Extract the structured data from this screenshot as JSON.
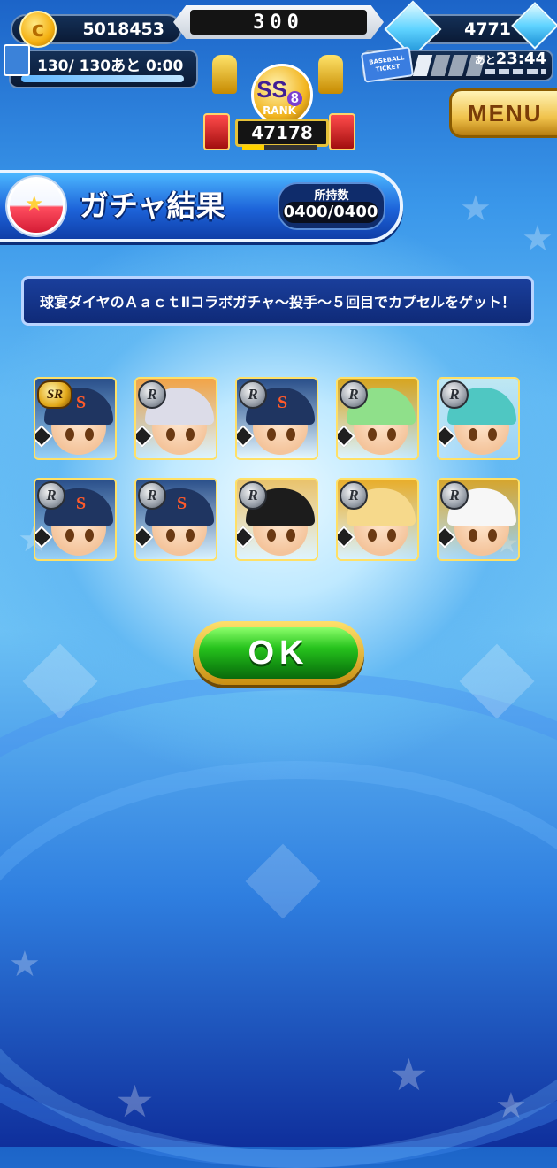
{
  "topbar": {
    "coins": "5018453",
    "center_value": "300",
    "gems": "4771",
    "stamina": "130/ 130あと 0:00",
    "ticket_label": "BASEBALL TICKET",
    "ticket_time_prefix": "あと",
    "ticket_time": "23:44"
  },
  "rank": {
    "grade": "SS",
    "grade_number": "8",
    "label": "RANK",
    "value": "47178"
  },
  "menu": {
    "label": "MENU"
  },
  "result": {
    "title": "ガチャ結果",
    "owned_label": "所持数",
    "owned_value": "0400/0400"
  },
  "message": "球宴ダイヤのＡａｃｔⅡコラボガチャ～投手～５回目でカプセルをゲット！",
  "cards": [
    {
      "rarity": "SR",
      "team": "S",
      "theme": "navy-cap"
    },
    {
      "rarity": "R",
      "team": "",
      "theme": "silver-hair"
    },
    {
      "rarity": "R",
      "team": "S",
      "theme": "navy-cap"
    },
    {
      "rarity": "R",
      "team": "",
      "theme": "green-hair"
    },
    {
      "rarity": "R",
      "team": "",
      "theme": "teal-hair"
    },
    {
      "rarity": "R",
      "team": "S",
      "theme": "navy-cap"
    },
    {
      "rarity": "R",
      "team": "S",
      "theme": "navy-cap"
    },
    {
      "rarity": "R",
      "team": "",
      "theme": "black-hair"
    },
    {
      "rarity": "R",
      "team": "",
      "theme": "blonde-hair"
    },
    {
      "rarity": "R",
      "team": "",
      "theme": "white-cap"
    }
  ],
  "ok_button": {
    "label": "OK"
  },
  "colors": {
    "card_border": "#ffe066",
    "ok_green": "#27c31d",
    "banner_blue": "#1d63d9"
  }
}
